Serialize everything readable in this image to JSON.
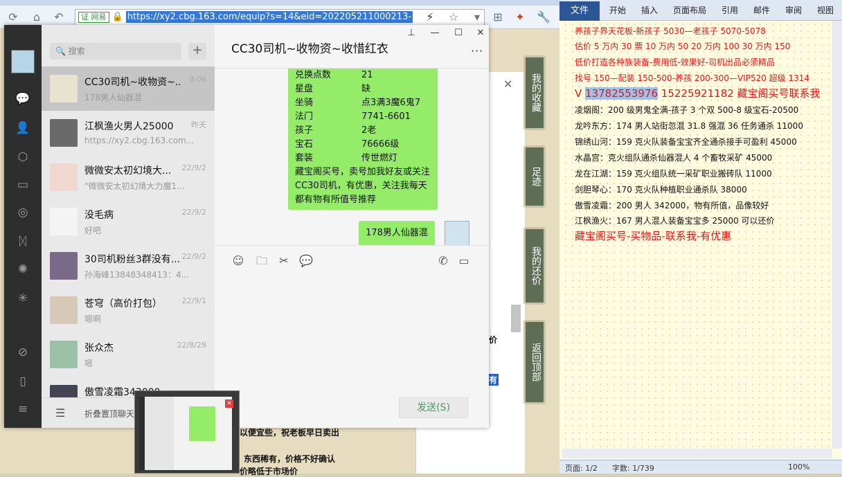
{
  "browser": {
    "cert_label": "证 网易",
    "url": "https://xy2.cbg.163.com/equip?s=14&eid=202205211000213-"
  },
  "webpage": {
    "price_fragment": "价",
    "tag_fragment": "有",
    "line1": "以便宜些，祝老板早日卖出",
    "line2": "东西稀有，价格不好确认",
    "line3": "价略低于市场价",
    "side_links": [
      "我的收藏",
      "足迹",
      "我的还价",
      "返回顶部"
    ]
  },
  "wechat": {
    "search_placeholder": "搜索",
    "add_label": "+",
    "chats": [
      {
        "name": "CC30司机~收物资~...",
        "time": "9:06",
        "preview": "178男人仙器混",
        "selected": true
      },
      {
        "name": "江枫渔火男人25000",
        "time": "昨天",
        "preview": "https://xy2.cbg.163.com..."
      },
      {
        "name": "微微安太初幻境大...",
        "time": "22/9/2",
        "preview": "\"微微安太初幻境大力魔1..."
      },
      {
        "name": "没毛病",
        "time": "22/9/2",
        "preview": "好吧"
      },
      {
        "name": "30司机粉丝3群没有...",
        "time": "22/9/2",
        "preview": "孙海峰13848348413：4..."
      },
      {
        "name": "苍穹（高价打包）",
        "time": "22/9/1",
        "preview": "嗯啊"
      },
      {
        "name": "张众杰",
        "time": "22/8/29",
        "preview": "嗯"
      },
      {
        "name": "傲雪凌霜343000...",
        "time": "",
        "preview": ""
      }
    ],
    "bottom_label": "折叠置顶聊天",
    "chat_title": "CC30司机~收物资~收惜红衣",
    "more_icon": "···",
    "message_rows": [
      {
        "k": "兑换点数",
        "v": "21"
      },
      {
        "k": "星盘",
        "v": "缺"
      },
      {
        "k": "坐骑",
        "v": "点3满3魔6鬼7"
      },
      {
        "k": "法门",
        "v": "7741-6601"
      },
      {
        "k": "孩子",
        "v": "2老"
      },
      {
        "k": "宝石",
        "v": "76666级"
      },
      {
        "k": "套装",
        "v": "传世燃灯"
      }
    ],
    "message_tail": "藏宝阁买号，卖号加我好友或关注CC30司机，有优惠，关注我每天都有物有所值号推荐",
    "my_message": "178男人仙器混",
    "send_label": "发送(S)"
  },
  "word": {
    "tabs": [
      "文件",
      "开始",
      "插入",
      "页面布局",
      "引用",
      "邮件",
      "审阅",
      "视图"
    ],
    "lines": [
      {
        "text": "养孩子界天花板-新孩子 5030—老孩子 5070-5078",
        "red": true
      },
      {
        "text": "估价 5 万内 30 票  10 万内 50  20 万内 100  30 万内 150",
        "red": true
      },
      {
        "text": "低价打造各种族装备-费用低-效果好-司机出品必须精品",
        "red": true
      },
      {
        "text": "找号 150—配装 150-500-养孩 200-300—VIP520 超级 1314",
        "red": true
      },
      {
        "text": "   15225921182  藏宝阁买号联系我",
        "red": true,
        "big": true,
        "prefix": "V",
        "hl": "13782553976"
      },
      {
        "text": "凌烟阁：200 级男鬼全满-孩子 3 个双 500-8 级宝石-20500"
      },
      {
        "text": "龙吟东方：174 男人站街忽混 31.8 强混 36 任务通杀 11000"
      },
      {
        "text": "锦绣山河：159 克火队装备宝宝齐全通杀接手可盈利 45000"
      },
      {
        "text": "水晶宫：克火组队通杀仙器混人 4 个畜牧采矿 45000"
      },
      {
        "text": "龙在江湖：159 克火组队统一采矿职业搬砖队 11000"
      },
      {
        "text": "剑胆琴心：170 克火队种植职业通杀队 38000"
      },
      {
        "text": "傲雪凌霜：200 男人 342000，物有所值，品像较好"
      },
      {
        "text": "江枫渔火：167 男人混人装备宝宝多 25000 可以还价"
      },
      {
        "text": "藏宝阁买号-买物品-联系我-有优惠",
        "red": true,
        "big": true
      }
    ],
    "status_pages": "页面: 1/2",
    "status_words": "字数: 1/739",
    "zoom": "100%"
  }
}
